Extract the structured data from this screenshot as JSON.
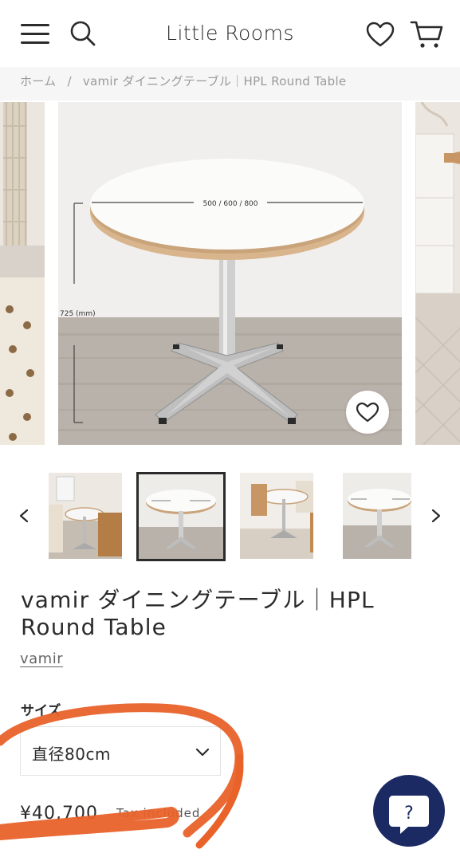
{
  "header": {
    "logo": "Little Rooms",
    "menu_icon": "hamburger-menu-icon",
    "search_icon": "search-icon",
    "wishlist_icon": "heart-icon",
    "cart_icon": "cart-icon"
  },
  "breadcrumb": {
    "home": "ホーム",
    "separator": "/",
    "current": "vamir ダイニングテーブル｜HPL Round Table"
  },
  "gallery": {
    "dimension_width": "500 / 600 / 800",
    "dimension_height": "725 (mm)",
    "favorite_icon": "heart-outline-icon"
  },
  "thumbnails": {
    "prev_icon": "chevron-left-icon",
    "next_icon": "chevron-right-icon",
    "active_index": 1,
    "count": 4
  },
  "product": {
    "title": "vamir ダイニングテーブル｜HPL Round Table",
    "vendor": "vamir",
    "size_label": "サイズ",
    "size_selected": "直径80cm",
    "price": "¥40,700",
    "tax_note": "Tax included."
  },
  "help": {
    "icon": "question-chat-icon",
    "label": "?"
  },
  "colors": {
    "text": "#2b2b2b",
    "muted": "#9a9a9a",
    "help_bg": "#1b2a63",
    "annotation": "#e8622a"
  }
}
